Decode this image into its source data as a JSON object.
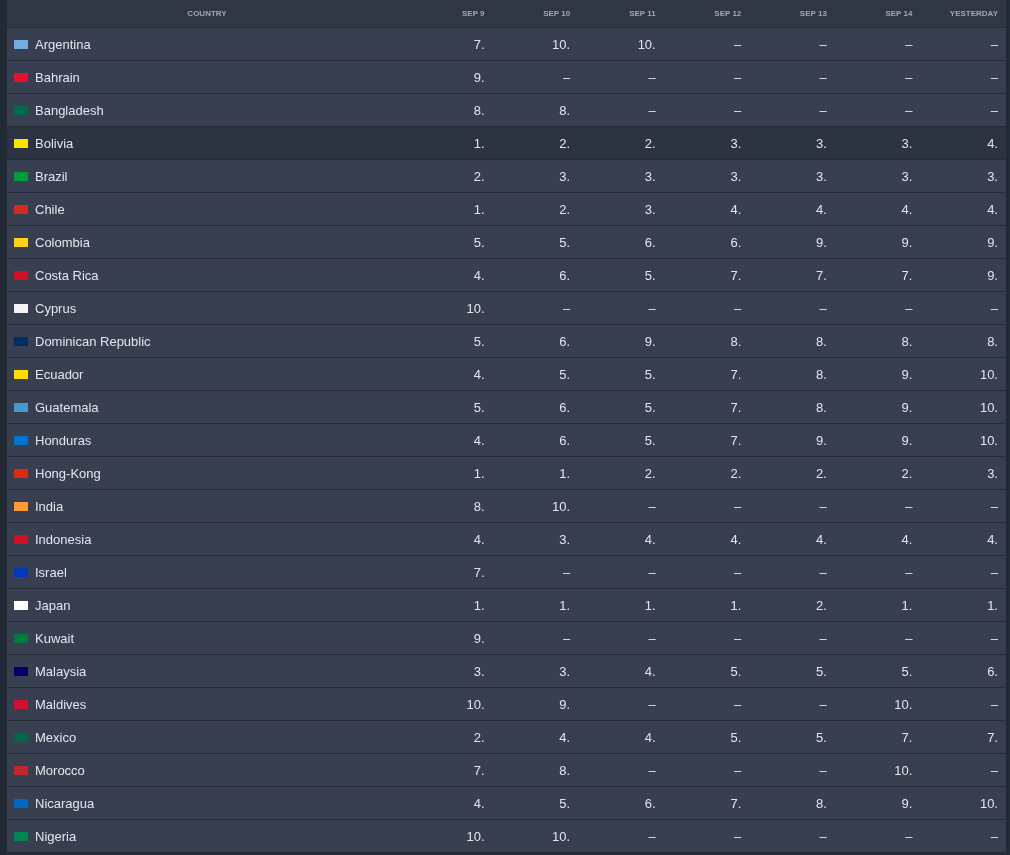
{
  "table": {
    "columns": [
      "COUNTRY",
      "SEP 9",
      "SEP 10",
      "SEP 11",
      "SEP 12",
      "SEP 13",
      "SEP 14",
      "YESTERDAY"
    ],
    "rows": [
      {
        "country": "Argentina",
        "color": "#74acdf",
        "selected": false,
        "values": [
          "7.",
          "10.",
          "10.",
          "–",
          "–",
          "–",
          "–"
        ]
      },
      {
        "country": "Bahrain",
        "color": "#e8112d",
        "selected": false,
        "values": [
          "9.",
          "–",
          "–",
          "–",
          "–",
          "–",
          "–"
        ]
      },
      {
        "country": "Bangladesh",
        "color": "#006a4e",
        "selected": false,
        "values": [
          "8.",
          "8.",
          "–",
          "–",
          "–",
          "–",
          "–"
        ]
      },
      {
        "country": "Bolivia",
        "color": "#f9e300",
        "selected": true,
        "values": [
          "1.",
          "2.",
          "2.",
          "3.",
          "3.",
          "3.",
          "4."
        ]
      },
      {
        "country": "Brazil",
        "color": "#009c3b",
        "selected": false,
        "values": [
          "2.",
          "3.",
          "3.",
          "3.",
          "3.",
          "3.",
          "3."
        ]
      },
      {
        "country": "Chile",
        "color": "#d52b1e",
        "selected": false,
        "values": [
          "1.",
          "2.",
          "3.",
          "4.",
          "4.",
          "4.",
          "4."
        ]
      },
      {
        "country": "Colombia",
        "color": "#fcd116",
        "selected": false,
        "values": [
          "5.",
          "5.",
          "6.",
          "6.",
          "9.",
          "9.",
          "9."
        ]
      },
      {
        "country": "Costa Rica",
        "color": "#ce1126",
        "selected": false,
        "values": [
          "4.",
          "6.",
          "5.",
          "7.",
          "7.",
          "7.",
          "9."
        ]
      },
      {
        "country": "Cyprus",
        "color": "#f4f4f4",
        "selected": false,
        "values": [
          "10.",
          "–",
          "–",
          "–",
          "–",
          "–",
          "–"
        ]
      },
      {
        "country": "Dominican Republic",
        "color": "#002d62",
        "selected": false,
        "values": [
          "5.",
          "6.",
          "9.",
          "8.",
          "8.",
          "8.",
          "8."
        ]
      },
      {
        "country": "Ecuador",
        "color": "#ffdd00",
        "selected": false,
        "values": [
          "4.",
          "5.",
          "5.",
          "7.",
          "8.",
          "9.",
          "10."
        ]
      },
      {
        "country": "Guatemala",
        "color": "#4997d0",
        "selected": false,
        "values": [
          "5.",
          "6.",
          "5.",
          "7.",
          "8.",
          "9.",
          "10."
        ]
      },
      {
        "country": "Honduras",
        "color": "#0073cf",
        "selected": false,
        "values": [
          "4.",
          "6.",
          "5.",
          "7.",
          "9.",
          "9.",
          "10."
        ]
      },
      {
        "country": "Hong-Kong",
        "color": "#de2910",
        "selected": false,
        "values": [
          "1.",
          "1.",
          "2.",
          "2.",
          "2.",
          "2.",
          "3."
        ]
      },
      {
        "country": "India",
        "color": "#ff9933",
        "selected": false,
        "values": [
          "8.",
          "10.",
          "–",
          "–",
          "–",
          "–",
          "–"
        ]
      },
      {
        "country": "Indonesia",
        "color": "#ce1127",
        "selected": false,
        "values": [
          "4.",
          "3.",
          "4.",
          "4.",
          "4.",
          "4.",
          "4."
        ]
      },
      {
        "country": "Israel",
        "color": "#0038b8",
        "selected": false,
        "values": [
          "7.",
          "–",
          "–",
          "–",
          "–",
          "–",
          "–"
        ]
      },
      {
        "country": "Japan",
        "color": "#ffffff",
        "selected": false,
        "values": [
          "1.",
          "1.",
          "1.",
          "1.",
          "2.",
          "1.",
          "1."
        ]
      },
      {
        "country": "Kuwait",
        "color": "#007a3d",
        "selected": false,
        "values": [
          "9.",
          "–",
          "–",
          "–",
          "–",
          "–",
          "–"
        ]
      },
      {
        "country": "Malaysia",
        "color": "#010066",
        "selected": false,
        "values": [
          "3.",
          "3.",
          "4.",
          "5.",
          "5.",
          "5.",
          "6."
        ]
      },
      {
        "country": "Maldives",
        "color": "#d21034",
        "selected": false,
        "values": [
          "10.",
          "9.",
          "–",
          "–",
          "–",
          "10.",
          "–"
        ]
      },
      {
        "country": "Mexico",
        "color": "#006847",
        "selected": false,
        "values": [
          "2.",
          "4.",
          "4.",
          "5.",
          "5.",
          "7.",
          "7."
        ]
      },
      {
        "country": "Morocco",
        "color": "#c1272d",
        "selected": false,
        "values": [
          "7.",
          "8.",
          "–",
          "–",
          "–",
          "10.",
          "–"
        ]
      },
      {
        "country": "Nicaragua",
        "color": "#0067c6",
        "selected": false,
        "values": [
          "4.",
          "5.",
          "6.",
          "7.",
          "8.",
          "9.",
          "10."
        ]
      },
      {
        "country": "Nigeria",
        "color": "#008751",
        "selected": false,
        "values": [
          "10.",
          "10.",
          "–",
          "–",
          "–",
          "–",
          "–"
        ]
      }
    ]
  }
}
